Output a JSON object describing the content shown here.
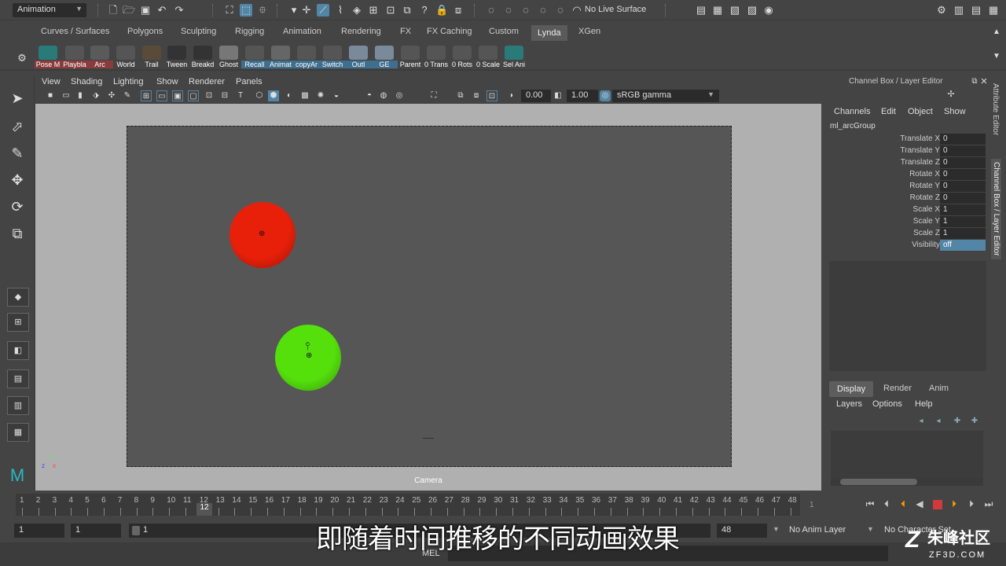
{
  "status_line": {
    "mode": "Animation",
    "live_surface": "No Live Surface"
  },
  "shelf_tabs": [
    "Curves / Surfaces",
    "Polygons",
    "Sculpting",
    "Rigging",
    "Animation",
    "Rendering",
    "FX",
    "FX Caching",
    "Custom",
    "Lynda",
    "XGen"
  ],
  "shelf_active": "Lynda",
  "shelf_buttons": [
    "Pose M",
    "Playbla",
    "Arc",
    "World",
    "Trail",
    "Tween",
    "Breakd",
    "Ghost",
    "Recall",
    "Animat",
    "copyAr",
    "Switch",
    "Outl",
    "GE",
    "Parent",
    "0 Trans",
    "0 Rots",
    "0 Scale",
    "Sel Ani"
  ],
  "panel_menu": [
    "View",
    "Shading",
    "Lighting",
    "Show",
    "Renderer",
    "Panels"
  ],
  "panel_toolbar": {
    "exposure": "0.00",
    "gamma_value": "1.00",
    "color_space": "sRGB gamma"
  },
  "viewport": {
    "camera_label": "Camera",
    "balls": [
      {
        "name": "red-ball",
        "color": "#e8200a"
      },
      {
        "name": "green-ball",
        "color": "#55e00c"
      }
    ]
  },
  "channel_box": {
    "title": "Channel Box / Layer Editor",
    "menu": [
      "Channels",
      "Edit",
      "Object",
      "Show"
    ],
    "object": "ml_arcGroup",
    "attributes": [
      {
        "name": "Translate X",
        "value": "0"
      },
      {
        "name": "Translate Y",
        "value": "0"
      },
      {
        "name": "Translate Z",
        "value": "0"
      },
      {
        "name": "Rotate X",
        "value": "0"
      },
      {
        "name": "Rotate Y",
        "value": "0"
      },
      {
        "name": "Rotate Z",
        "value": "0"
      },
      {
        "name": "Scale X",
        "value": "1"
      },
      {
        "name": "Scale Y",
        "value": "1"
      },
      {
        "name": "Scale Z",
        "value": "1"
      },
      {
        "name": "Visibility",
        "value": "off"
      }
    ],
    "display_tabs": [
      "Display",
      "Render",
      "Anim"
    ],
    "layer_menu": [
      "Layers",
      "Options",
      "Help"
    ]
  },
  "side_tabs": [
    "Attribute Editor",
    "Channel Box / Layer Editor"
  ],
  "time_slider": {
    "frames": [
      "1",
      "2",
      "3",
      "4",
      "5",
      "6",
      "7",
      "8",
      "9",
      "10",
      "11",
      "12",
      "13",
      "14",
      "15",
      "16",
      "17",
      "18",
      "19",
      "20",
      "21",
      "22",
      "23",
      "24",
      "25",
      "26",
      "27",
      "28",
      "29",
      "30",
      "31",
      "32",
      "33",
      "34",
      "35",
      "36",
      "37",
      "38",
      "39",
      "40",
      "41",
      "42",
      "43",
      "44",
      "45",
      "46",
      "47",
      "48"
    ],
    "current_frame": "12",
    "right_field": "1"
  },
  "range_slider": {
    "start": "1",
    "playback_start": "1",
    "range_label": "1",
    "end": "48",
    "anim_layer": "No Anim Layer",
    "character_set": "No Character Set"
  },
  "command_line": {
    "label": "MEL"
  },
  "subtitle": "即随着时间推移的不同动画效果",
  "watermark": {
    "line1": "朱峰社区",
    "line2": "ZF3D.COM"
  }
}
